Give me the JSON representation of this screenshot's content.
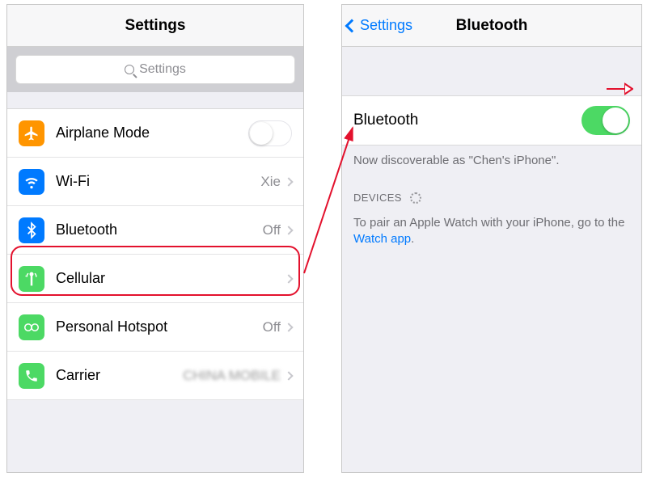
{
  "left": {
    "title": "Settings",
    "search_placeholder": "Settings",
    "rows": {
      "airplane": {
        "label": "Airplane Mode"
      },
      "wifi": {
        "label": "Wi-Fi",
        "value": "Xie"
      },
      "bluetooth": {
        "label": "Bluetooth",
        "value": "Off"
      },
      "cellular": {
        "label": "Cellular"
      },
      "hotspot": {
        "label": "Personal Hotspot",
        "value": "Off"
      },
      "carrier": {
        "label": "Carrier",
        "value": "CHINA MOBILE"
      }
    }
  },
  "right": {
    "back_label": "Settings",
    "title": "Bluetooth",
    "toggle_label": "Bluetooth",
    "discoverable_text": "Now discoverable as \"Chen's iPhone\".",
    "devices_header": "DEVICES",
    "pair_text_before": "To pair an Apple Watch with your iPhone, go to the ",
    "pair_link": "Watch app",
    "pair_text_after": "."
  }
}
